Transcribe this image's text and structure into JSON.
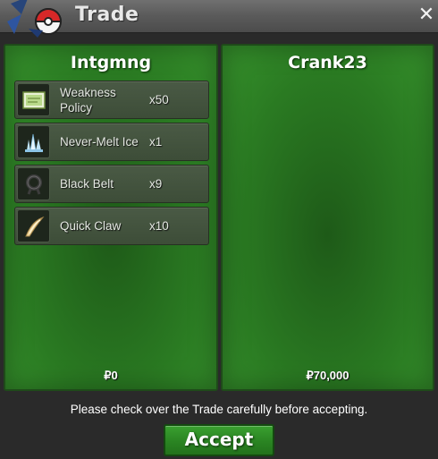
{
  "window": {
    "title": "Trade",
    "close_label": "✕"
  },
  "left_trader": {
    "name": "Intgmng",
    "items": [
      {
        "name": "Weakness Policy",
        "qty": "x50",
        "icon": "weakness-policy-icon"
      },
      {
        "name": "Never-Melt Ice",
        "qty": "x1",
        "icon": "never-melt-ice-icon"
      },
      {
        "name": "Black Belt",
        "qty": "x9",
        "icon": "black-belt-icon"
      },
      {
        "name": "Quick Claw",
        "qty": "x10",
        "icon": "quick-claw-icon"
      }
    ],
    "money": "₽0"
  },
  "right_trader": {
    "name": "Crank23",
    "items": [],
    "money": "₽70,000"
  },
  "footer": {
    "message": "Please check over the Trade carefully before accepting.",
    "accept_label": "Accept"
  },
  "colors": {
    "panel_green": "#2a7a22",
    "accept_green": "#2a8422",
    "titlebar": "#5a5a5a"
  }
}
